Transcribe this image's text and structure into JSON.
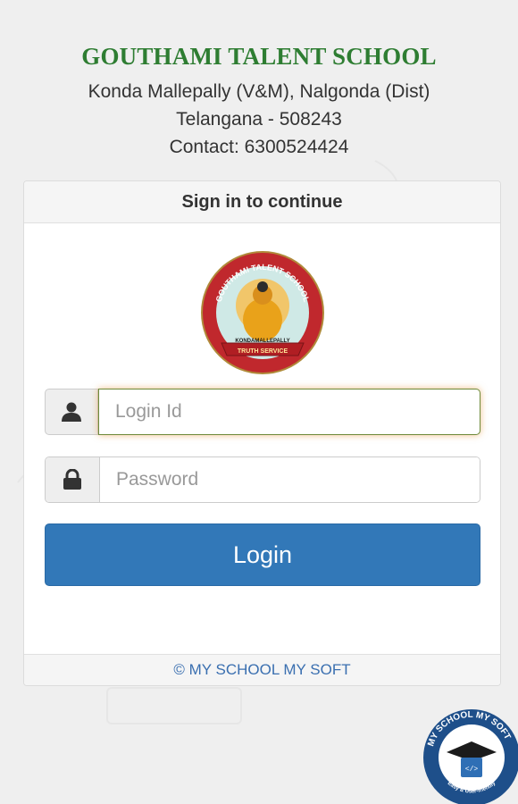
{
  "header": {
    "school_name": "GOUTHAMI TALENT SCHOOL",
    "address_line1": "Konda Mallepally (V&M), Nalgonda (Dist)",
    "address_line2": "Telangana - 508243",
    "contact": "Contact: 6300524424"
  },
  "card": {
    "title": "Sign in to continue",
    "logo": {
      "top_text": "GOUTHAMI TALENT SCHOOL",
      "band_text": "KONDAMALLEPALLY",
      "ribbon_text": "TRUTH SERVICE"
    },
    "login_field": {
      "placeholder": "Login Id",
      "value": "",
      "icon": "user-icon"
    },
    "password_field": {
      "placeholder": "Password",
      "value": "",
      "icon": "lock-icon"
    },
    "login_button": "Login",
    "footer": "© MY SCHOOL MY SOFT"
  },
  "badge": {
    "top_text": "MY SCHOOL MY SOFT",
    "bottom_text": "Easy & User-friendly"
  },
  "colors": {
    "school_name": "#2e7d32",
    "button": "#3278b8",
    "footer_link": "#3a6fb0",
    "badge": "#1e4f8a"
  }
}
